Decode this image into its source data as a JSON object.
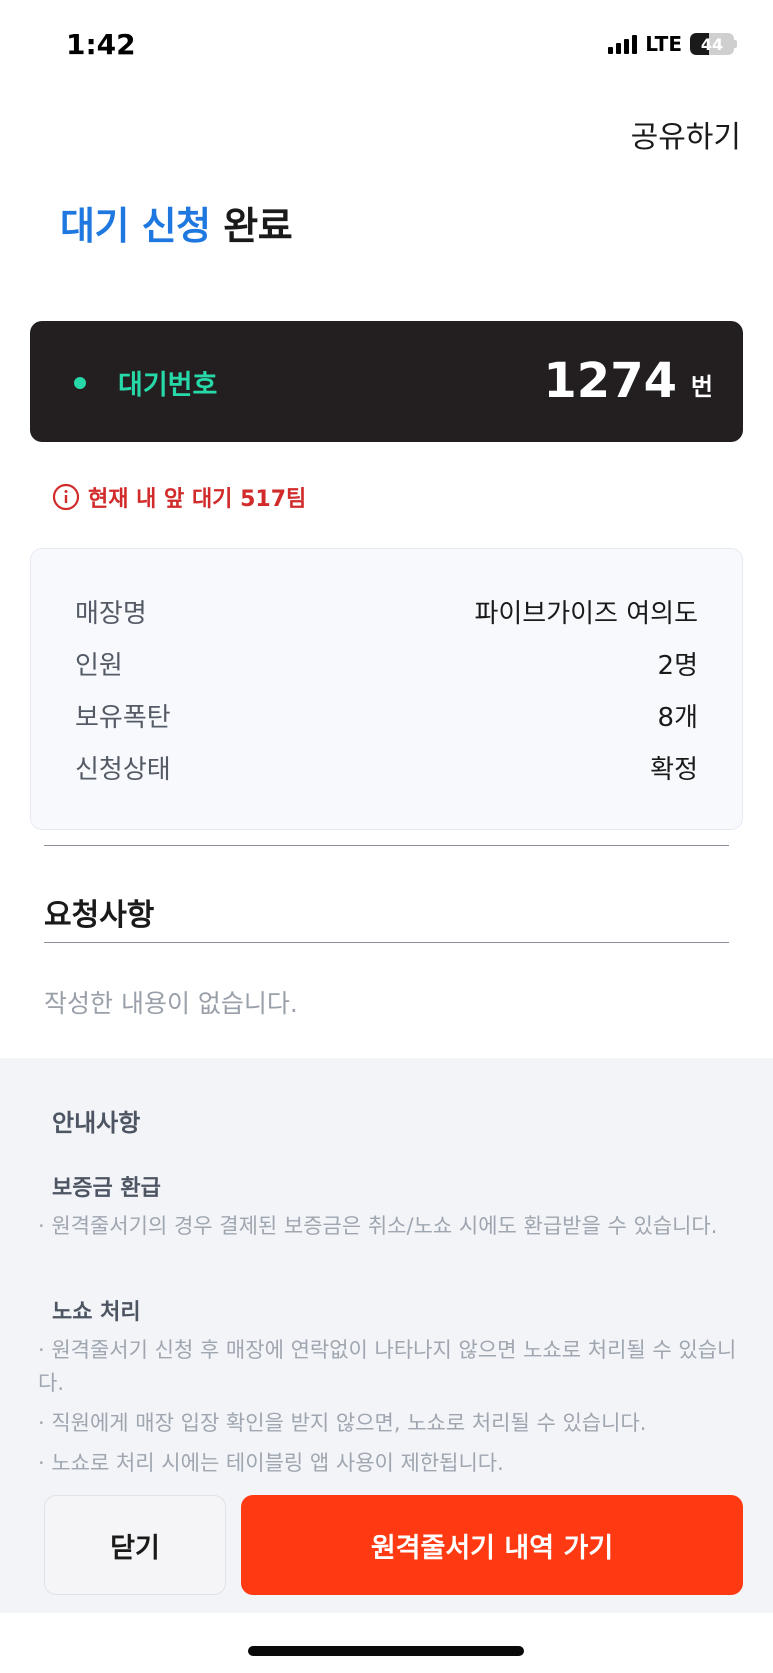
{
  "status_bar": {
    "time": "1:42",
    "network": "LTE",
    "battery": "44",
    "battery_percent": 44
  },
  "header": {
    "share_label": "공유하기"
  },
  "title": {
    "accent": "대기 신청",
    "rest": " 완료"
  },
  "queue": {
    "label": "대기번호",
    "number": "1274",
    "unit": "번"
  },
  "ahead": {
    "text": "현재 내 앞 대기 517팀"
  },
  "details": [
    {
      "label": "매장명",
      "value": "파이브가이즈 여의도"
    },
    {
      "label": "인원",
      "value": "2명"
    },
    {
      "label": "보유폭탄",
      "value": "8개"
    },
    {
      "label": "신청상태",
      "value": "확정"
    }
  ],
  "request": {
    "title": "요청사항",
    "empty_text": "작성한 내용이 없습니다."
  },
  "notice": {
    "title": "안내사항",
    "refund_title": "보증금 환급",
    "refund_text": "· 원격줄서기의 경우 결제된 보증금은 취소/노쇼 시에도 환급받을 수 있습니다.",
    "noshow_title": "노쇼 처리",
    "noshow_items": [
      "· 원격줄서기 신청 후 매장에 연락없이 나타나지 않으면 노쇼로 처리될 수 있습니다.",
      "· 직원에게 매장 입장 확인을 받지 않으면, 노쇼로 처리될 수 있습니다.",
      "· 노쇼로 처리 시에는 테이블링 앱 사용이 제한됩니다."
    ]
  },
  "buttons": {
    "close_label": "닫기",
    "history_label": "원격줄서기 내역 가기"
  },
  "colors": {
    "accent_blue": "#1f78e0",
    "queue_green": "#27d9a8",
    "warning_red": "#d12b2b",
    "primary_orange": "#ff3a12"
  }
}
